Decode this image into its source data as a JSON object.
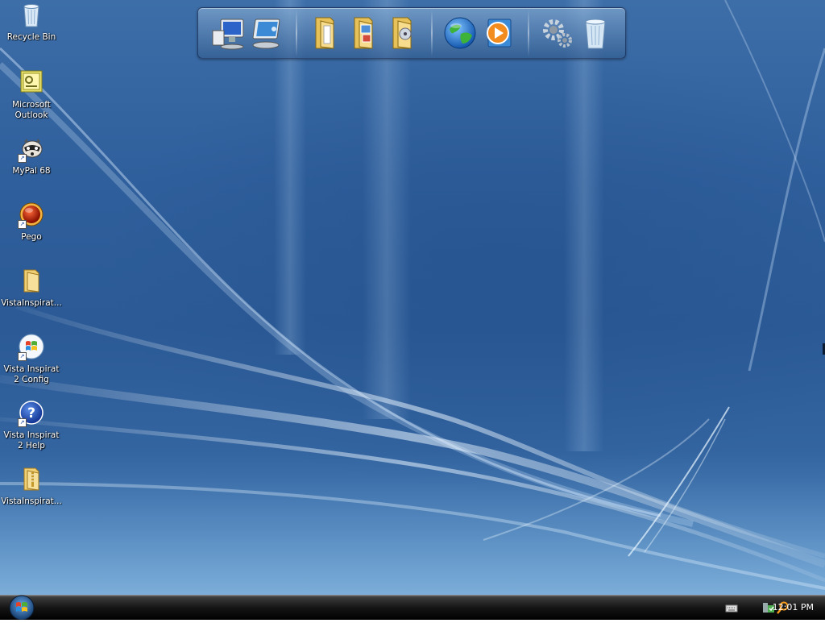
{
  "desktop": {
    "icons": [
      {
        "label": "Recycle Bin",
        "icon": "recycle-bin-icon"
      },
      {
        "label": "Microsoft Outlook",
        "icon": "outlook-icon"
      },
      {
        "label": "MyPal 68",
        "icon": "mypal-raccoon-icon"
      },
      {
        "label": "Pego",
        "icon": "pego-red-orb-icon"
      },
      {
        "label": "VistaInspirat...",
        "icon": "folder-icon"
      },
      {
        "label": "Vista Inspirat 2 Config",
        "icon": "windows-logo-icon"
      },
      {
        "label": "Vista Inspirat 2 Help",
        "icon": "help-icon"
      },
      {
        "label": "VistaInspirat...",
        "icon": "zip-folder-icon"
      }
    ]
  },
  "dock": {
    "items": [
      {
        "icon": "my-computer-icon"
      },
      {
        "icon": "control-panel-display-icon"
      },
      {
        "icon": "documents-folder-icon"
      },
      {
        "icon": "pictures-folder-icon"
      },
      {
        "icon": "music-folder-icon"
      },
      {
        "icon": "internet-globe-icon"
      },
      {
        "icon": "media-player-icon"
      },
      {
        "icon": "settings-gears-icon"
      },
      {
        "icon": "recycle-bin-icon"
      }
    ]
  },
  "taskbar": {
    "start_icon": "windows-start-orb-icon",
    "tray_icons": [
      "keyboard-icon",
      "security-shield-icon",
      "search-magnifier-icon"
    ],
    "clock": "12:01 PM"
  }
}
